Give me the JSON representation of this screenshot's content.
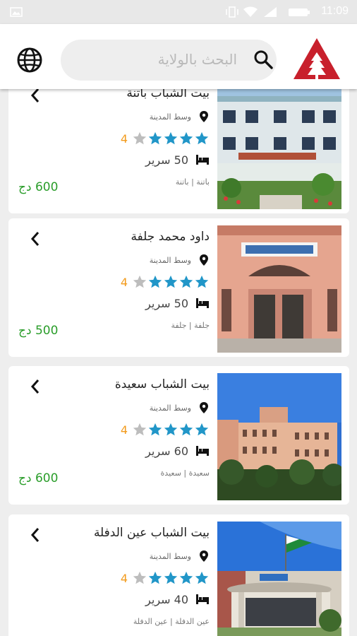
{
  "status_bar": {
    "time": "11:09"
  },
  "header": {
    "search_placeholder": "البحث بالولاية",
    "icons": [
      "globe-icon",
      "search-icon",
      "app-logo"
    ],
    "brand_color": "#c8202c"
  },
  "hostels": [
    {
      "name": "بيت الشباب باتنة",
      "location": "وسط المدينة",
      "rating": "4",
      "stars": 4,
      "beds": "50 سرير",
      "region": "باتنة | باتنة",
      "price": "600 دج"
    },
    {
      "name": "داود محمد جلفة",
      "location": "وسط المدينة",
      "rating": "4",
      "stars": 4,
      "beds": "50 سرير",
      "region": "جلفة | جلفة",
      "price": "500 دج"
    },
    {
      "name": "بيت الشباب سعيدة",
      "location": "وسط المدينة",
      "rating": "4",
      "stars": 4,
      "beds": "60 سرير",
      "region": "سعيدة | سعيدة",
      "price": "600 دج"
    },
    {
      "name": "بيت الشباب عين الدفلة",
      "location": "وسط المدينة",
      "rating": "4",
      "stars": 4,
      "beds": "40 سرير",
      "region": "عين الدفلة | عين الدفلة",
      "price": ""
    }
  ],
  "colors": {
    "star_filled": "#2196c8",
    "star_empty": "#bdbdbd",
    "rating_text": "#f29a1b",
    "price_text": "#2a9d2a"
  }
}
